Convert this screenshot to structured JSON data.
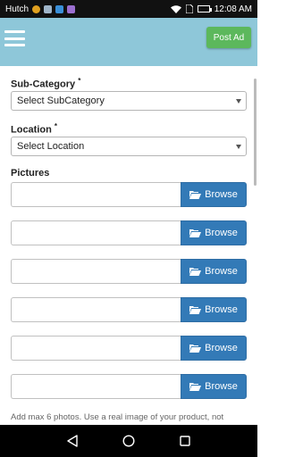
{
  "statusbar": {
    "carrier": "Hutch",
    "time": "12:08 AM",
    "icons": [
      "chrome-icon",
      "image-icon",
      "app-icon",
      "message-icon",
      "wifi-icon",
      "sim-icon",
      "battery-icon"
    ]
  },
  "header": {
    "menu_icon": "hamburger-icon",
    "post_ad_label": "Post Ad",
    "background_color": "#8ec7d9",
    "post_ad_color": "#5cb85c"
  },
  "form": {
    "subcategory": {
      "label": "Sub-Category",
      "required_mark": "*",
      "selected": "Select SubCategory"
    },
    "location": {
      "label": "Location",
      "required_mark": "*",
      "selected": "Select Location"
    },
    "pictures": {
      "label": "Pictures",
      "browse_label": "Browse",
      "browse_icon": "folder-open-icon",
      "slots": 6,
      "browse_color": "#337ab7"
    },
    "help_text": "Add max 6 photos. Use a real image of your product, not"
  },
  "navigation": {
    "buttons": [
      "back-icon",
      "home-icon",
      "recents-icon"
    ]
  }
}
